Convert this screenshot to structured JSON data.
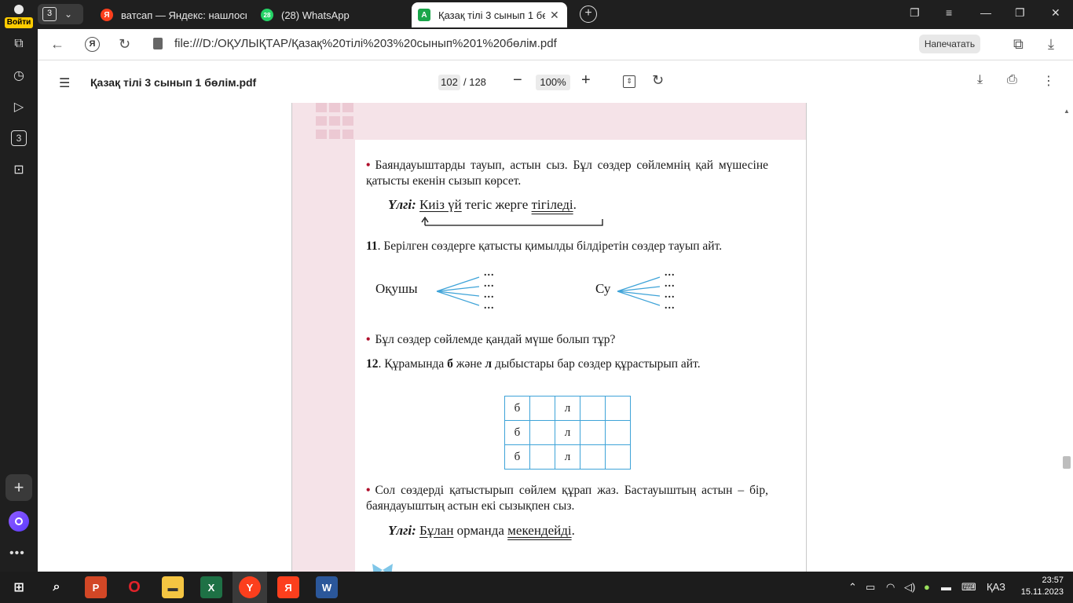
{
  "sidebar": {
    "signin_label": "Войти",
    "badge_num": "3"
  },
  "tabs": {
    "group_count": "3",
    "items": [
      {
        "title": "ватсап — Яндекс: нашлось",
        "favicon": "yandex-icon",
        "color": "#fc3f1d",
        "glyph": "Я"
      },
      {
        "title": "(28) WhatsApp",
        "favicon": "whatsapp-icon",
        "color": "#25d366",
        "glyph": "28"
      },
      {
        "title": "Қазақ тілі 3 сынып 1 бө",
        "favicon": "pdf-icon",
        "color": "#1aa64a",
        "glyph": "A"
      }
    ]
  },
  "address": {
    "url": "file:///D:/ОҚУЛЫҚТАР/Қазақ%20тілі%203%20сынып%201%20бөлім.pdf",
    "print_label": "Напечатать"
  },
  "pdf": {
    "title": "Қазақ тілі 3 сынып 1 бөлім.pdf",
    "page": "102",
    "total": "/ 128",
    "zoom": "100%"
  },
  "doc": {
    "task_a": "Баяндауыштарды тауып, астын сыз. Бұл сөздер сөйлемнің қай мүшесіне қатысты екенін сызып көрсет.",
    "sample_label": "Үлгі:",
    "sample1": {
      "w1": "Киіз үй",
      "w2": " тегіс жерге ",
      "w3": "тігіледі",
      "end": "."
    },
    "task11_num": "11",
    "task11": ". Берілген сөздерге қатысты қимылды білдіретін сөздер тауып айт.",
    "word_left": "Оқушы",
    "word_right": "Су",
    "dots": "...",
    "question": "Бұл сөздер сөйлемде қандай мүше болып тұр?",
    "task12_num": "12",
    "task12_a": ". Құрамында ",
    "task12_b": "б",
    "task12_c": " және ",
    "task12_d": "л",
    "task12_e": " дыбыстары бар сөздер құрастырып айт.",
    "grid": [
      [
        "б",
        "",
        "л",
        "",
        ""
      ],
      [
        "б",
        "",
        "л",
        "",
        ""
      ],
      [
        "б",
        "",
        "л",
        "",
        ""
      ]
    ],
    "task_b": "Сол сөздерді қатыстырып сөйлем құрап жаз. Бастауыштың астын – бір, баяндауыштың астын екі сызықпен сыз.",
    "sample2": {
      "w1": "Бұлан",
      "w2": " орманда ",
      "w3": "мекендейді",
      "end": "."
    }
  },
  "taskbar": {
    "lang": "ҚАЗ",
    "time": "23:57",
    "date": "15.11.2023"
  }
}
